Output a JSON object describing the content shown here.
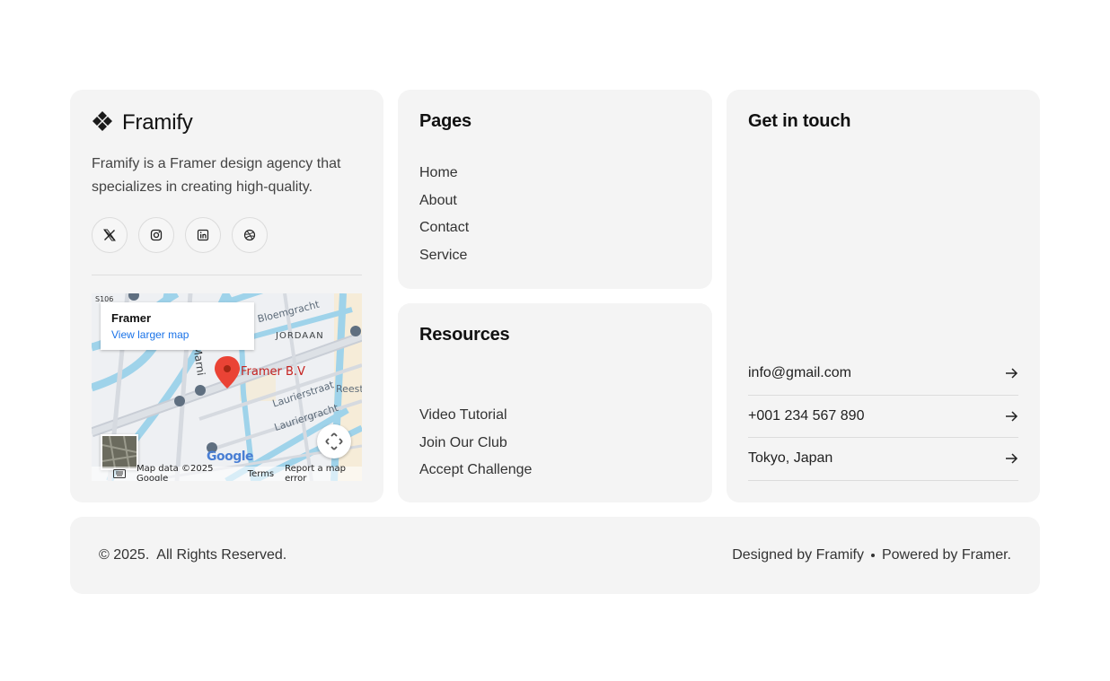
{
  "brand": {
    "name": "Framify",
    "description": "Framify is a Framer design agency that specializes in creating high-quality.",
    "socials": [
      {
        "name": "x-icon"
      },
      {
        "name": "instagram-icon"
      },
      {
        "name": "linkedin-icon"
      },
      {
        "name": "dribbble-icon"
      }
    ]
  },
  "map": {
    "popup_title": "Framer",
    "popup_link": "View larger map",
    "pin_label": "Framer B.V",
    "labels": {
      "bloemgracht": "Bloemgracht",
      "jordaan": "JORDAAN",
      "marnix": "Marni",
      "laurierstraat": "Laurierstraat",
      "lauriergracht": "Lauriergracht",
      "reest": "Reest",
      "route": "S106"
    },
    "logo": "Google",
    "footer": {
      "map_data": "Map data ©2025 Google",
      "terms": "Terms",
      "report": "Report a map error"
    }
  },
  "pages": {
    "title": "Pages",
    "links": [
      "Home",
      "About",
      "Contact",
      "Service"
    ]
  },
  "resources": {
    "title": "Resources",
    "links": [
      "Video Tutorial",
      "Join Our Club",
      "Accept Challenge"
    ]
  },
  "contact": {
    "title": "Get in touch",
    "items": [
      "info@gmail.com",
      "+001 234 567 890",
      "Tokyo, Japan"
    ]
  },
  "footer": {
    "copyright": "© 2025.  All Rights Reserved.",
    "designed": "Designed by Framify",
    "powered": "Powered by Framer."
  }
}
